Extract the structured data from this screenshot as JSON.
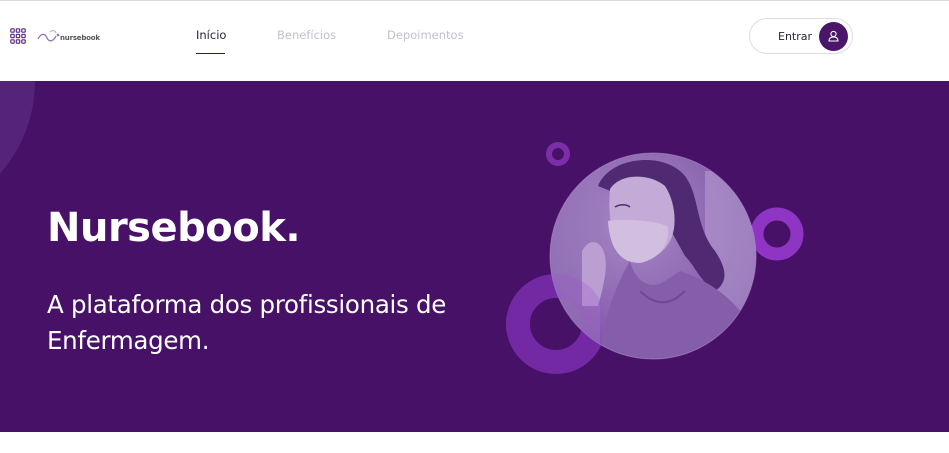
{
  "header": {
    "brand_name": "nursebook",
    "nav": [
      {
        "label": "Início",
        "active": true
      },
      {
        "label": "Benefícios",
        "active": false
      },
      {
        "label": "Depoimentos",
        "active": false
      }
    ],
    "login_label": "Entrar",
    "icons": {
      "apps": "grid-icon",
      "logo": "nursebook-logo",
      "user": "user-icon"
    }
  },
  "hero": {
    "title": "Nursebook.",
    "subtitle": "A plataforma dos profissionais de Enfermagem.",
    "image": "nurse-with-mask-photo"
  },
  "colors": {
    "brand_purple": "#461166",
    "accent_purple": "#8e35c4",
    "text_dark": "#2a2438",
    "nav_inactive": "#c3bfd0"
  }
}
